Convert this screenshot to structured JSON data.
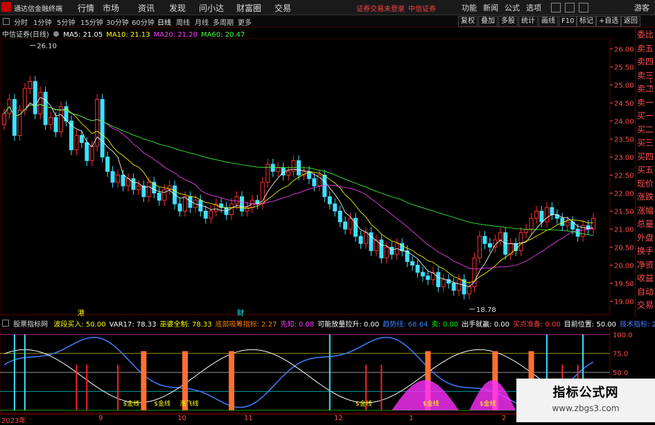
{
  "app": {
    "title": "通达信金融终端"
  },
  "menu": [
    "行情",
    "市场",
    "资讯",
    "发现",
    "问小达",
    "财富圈",
    "交易"
  ],
  "status": {
    "login": "证券交易未登录",
    "broker": "中信证券"
  },
  "menu_right": [
    "功能",
    "新闻",
    "公式",
    "选项"
  ],
  "guest": "游客",
  "period_tabs": [
    "分时",
    "1分钟",
    "5分钟",
    "15分钟",
    "30分钟",
    "60分钟",
    "日线",
    "周线",
    "月线",
    "多周期",
    "更多"
  ],
  "active_period": "日线",
  "toolbar_right": [
    "复权",
    "叠加",
    "多股",
    "统计",
    "画线",
    "F10",
    "标记",
    "+自选",
    "返回"
  ],
  "main": {
    "stock": "中信证券(日线)",
    "ma": [
      {
        "label": "MA5: 21.05",
        "color": "#ffffff"
      },
      {
        "label": "MA10: 21.13",
        "color": "#ffff00"
      },
      {
        "label": "MA20: 21.20",
        "color": "#ff40ff"
      },
      {
        "label": "MA60: 20.47",
        "color": "#40ff40"
      }
    ],
    "high_label": "26.10",
    "low_label": "18.78",
    "events": [
      {
        "label": "港"
      },
      {
        "label": "财"
      }
    ]
  },
  "right_panel": [
    "委比",
    "卖五",
    "卖四",
    "卖三",
    "卖二",
    "卖一",
    "买一",
    "买二",
    "买三",
    "买四",
    "买五",
    "现价",
    "涨跌",
    "涨幅",
    "总量",
    "外盘",
    "换手",
    "净资",
    "收益",
    "自动",
    "交易"
  ],
  "right_panel_small": [
    "L",
    "R"
  ],
  "indicator": {
    "name": "股票指标网",
    "items": [
      {
        "label": "波段买入: 50.00",
        "color": "#ffff00"
      },
      {
        "label": "VAR17: 78.33",
        "color": "#ffffff"
      },
      {
        "label": "巫婆全制: 78.33",
        "color": "#ffff00"
      },
      {
        "label": "底部吸筹指标: 2.27",
        "color": "#ff8000"
      },
      {
        "label": "先知: 0.08",
        "color": "#ff40ff"
      },
      {
        "label": "可能放量拉升: 0.00",
        "color": "#ffffff"
      },
      {
        "label": "趋势线: 68.64",
        "color": "#4080ff"
      },
      {
        "label": "卖: 0.00",
        "color": "#00ff00"
      },
      {
        "label": "出手就赢: 0.00",
        "color": "#ffffff"
      },
      {
        "label": "买点准备: 0.00",
        "color": "#ff4040"
      },
      {
        "label": "目前位置: 50.00",
        "color": "#ffffff"
      },
      {
        "label": "技术指标: 20",
        "color": "#4080ff"
      }
    ],
    "signals": [
      "$金线",
      "$金线",
      "涨飞线",
      "$金线",
      "$金线",
      "$金线"
    ]
  },
  "xaxis": {
    "year": "2023年",
    "months": [
      "9",
      "10",
      "11",
      "12",
      "1",
      "2"
    ]
  },
  "watermark": {
    "title": "指标公式网",
    "url": "www.zbgs3.com"
  },
  "chart_data": [
    {
      "type": "candlestick",
      "title": "中信证券(日线)",
      "y_axis_ticks": [
        26.0,
        25.5,
        25.0,
        24.5,
        24.0,
        23.5,
        23.0,
        22.5,
        22.0,
        21.5,
        21.0,
        20.5,
        20.0,
        19.5,
        19.0
      ],
      "ylim": [
        18.7,
        26.3
      ],
      "x_months": [
        "9",
        "10",
        "11",
        "12",
        "1",
        "2"
      ],
      "close": [
        24.2,
        24.6,
        23.6,
        24.3,
        24.9,
        25.1,
        24.2,
        24.8,
        23.9,
        24.1,
        23.7,
        24.4,
        24.0,
        23.2,
        23.6,
        23.4,
        22.9,
        23.3,
        24.6,
        23.0,
        22.6,
        22.3,
        22.5,
        22.2,
        22.4,
        22.1,
        22.2,
        21.9,
        22.3,
        22.0,
        21.8,
        22.1,
        22.2,
        21.7,
        21.5,
        21.9,
        21.6,
        21.8,
        21.5,
        21.3,
        21.5,
        21.7,
        21.6,
        21.4,
        21.7,
        21.9,
        21.5,
        21.6,
        21.8,
        21.7,
        22.3,
        22.8,
        22.6,
        22.7,
        22.5,
        22.6,
        22.9,
        22.5,
        22.6,
        22.4,
        22.2,
        22.5,
        21.9,
        21.7,
        21.5,
        21.2,
        21.0,
        21.3,
        20.8,
        20.6,
        20.9,
        20.4,
        20.7,
        20.2,
        20.5,
        20.3,
        20.6,
        20.4,
        20.1,
        20.0,
        19.8,
        19.7,
        19.6,
        19.8,
        19.4,
        19.6,
        19.5,
        19.3,
        19.6,
        19.2,
        19.4,
        20.2,
        20.8,
        20.6,
        20.5,
        20.7,
        20.9,
        20.3,
        20.6,
        20.4,
        20.9,
        21.0,
        21.3,
        21.5,
        21.2,
        21.6,
        21.4,
        21.3,
        21.1,
        21.2,
        21.0,
        20.8,
        21.1,
        21.0,
        21.3
      ],
      "series": [
        {
          "name": "MA5",
          "values": [
            21.05
          ]
        },
        {
          "name": "MA10",
          "values": [
            21.13
          ]
        },
        {
          "name": "MA20",
          "values": [
            21.2
          ]
        },
        {
          "name": "MA60",
          "values": [
            20.47
          ]
        }
      ],
      "annotations": [
        {
          "label": "26.10",
          "value": 26.1
        },
        {
          "label": "18.78",
          "value": 18.78
        }
      ]
    },
    {
      "type": "line",
      "title": "股票指标网",
      "y_axis_ticks": [
        100.0,
        75.0,
        50.0,
        25.0,
        0.0
      ],
      "ylim": [
        -2,
        104
      ],
      "series": [
        {
          "name": "VAR17",
          "values": [
            78.33
          ]
        },
        {
          "name": "趋势线",
          "values": [
            68.64
          ]
        },
        {
          "name": "波段买入",
          "values": [
            50.0
          ]
        }
      ]
    }
  ]
}
